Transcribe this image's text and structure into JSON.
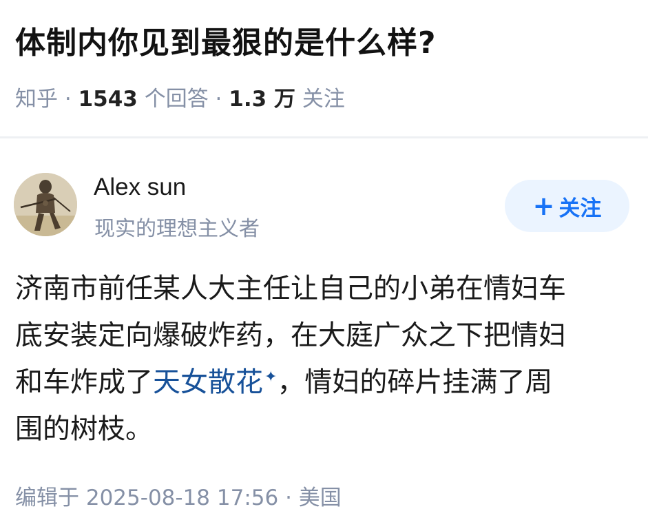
{
  "question": {
    "title": "体制内你见到最狠的是什么样?",
    "source": "知乎",
    "sep": " · ",
    "answer_count": "1543",
    "answer_unit": " 个回答",
    "follower_count": "1.3 万",
    "follower_unit": " 关注"
  },
  "author": {
    "name": "Alex sun",
    "bio": "现实的理想主义者",
    "avatar_icon": "warrior-portrait-avatar",
    "follow_label": "关注",
    "follow_plus": "+"
  },
  "answer": {
    "line1": "济南市前任某人大主任让自己的小弟在情妇车",
    "line2": "底安装定向爆破炸药，在大庭广众之下把情妇",
    "line3_before": "和车炸成了",
    "line3_link": "天女散花",
    "line3_after": "，情妇的碎片挂满了周",
    "line4": "围的树枝。",
    "link_marker_icon": "sparkle-icon"
  },
  "footer": {
    "edited_label": "编辑于",
    "edited_time": "2025-08-18 17:56",
    "sep": " · ",
    "location": "美国"
  },
  "colors": {
    "meta_gray": "#8590a6",
    "link_blue": "#175199",
    "follow_blue": "#1772f6",
    "follow_bg": "#ebf4ff"
  }
}
